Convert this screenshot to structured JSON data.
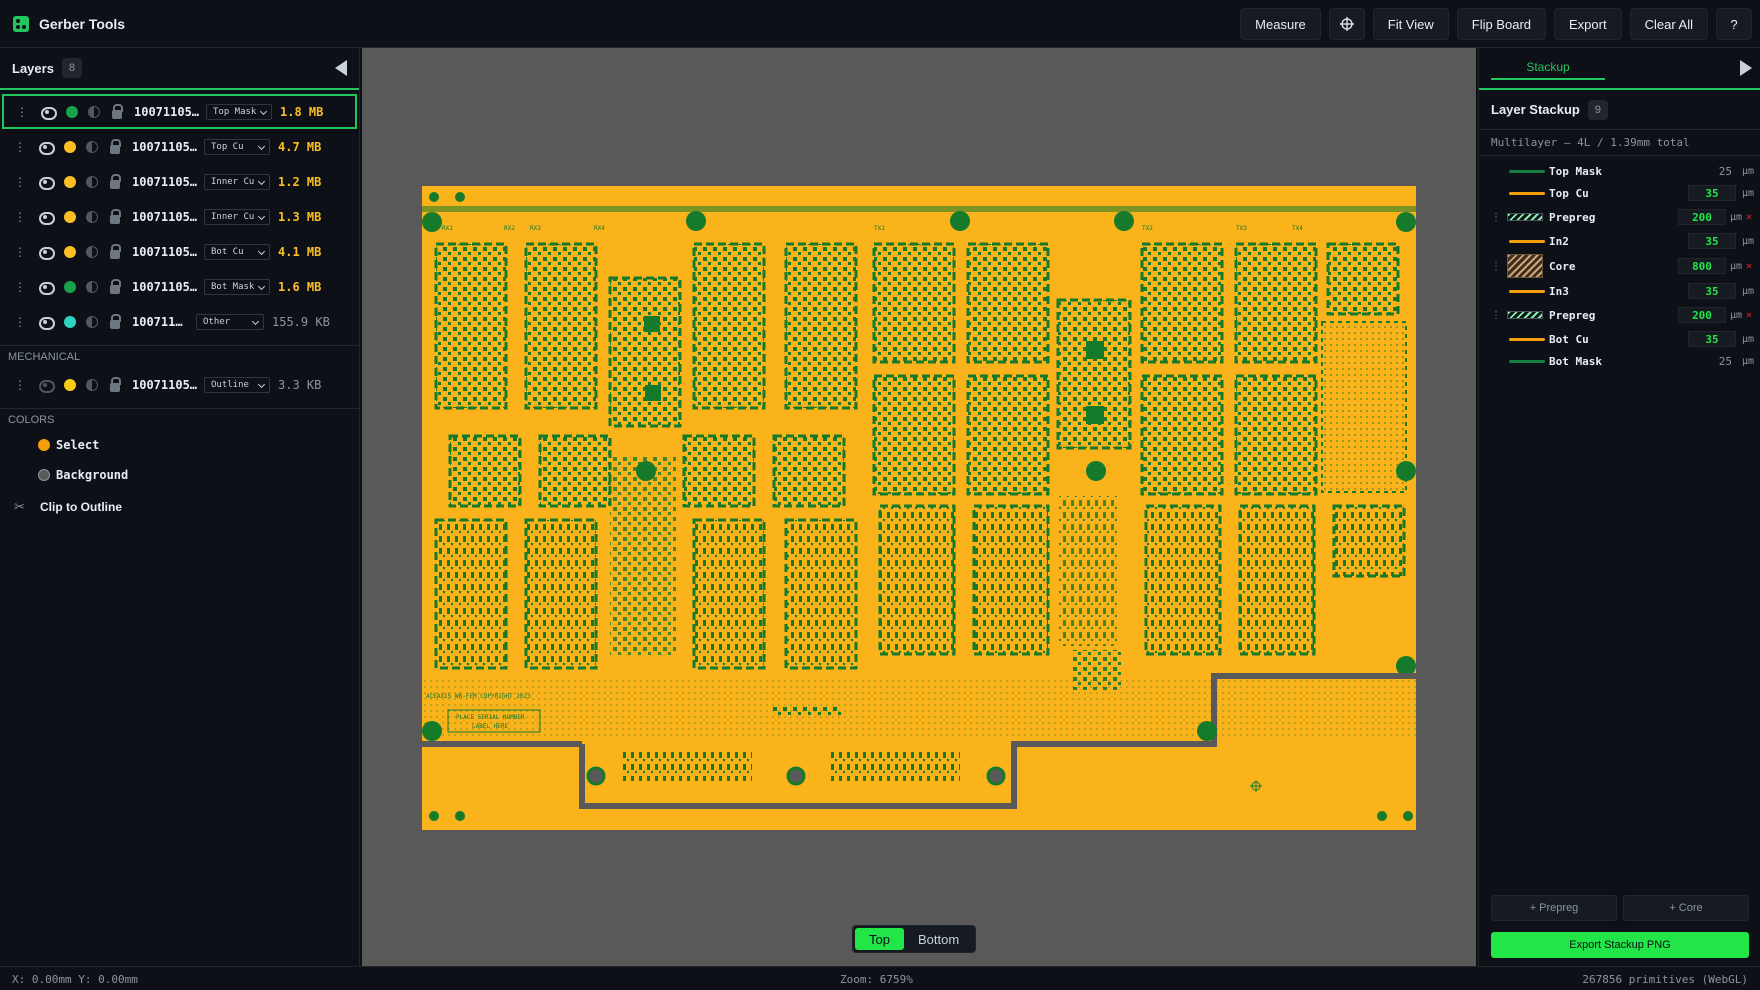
{
  "app": {
    "title": "Gerber Tools"
  },
  "toolbar": {
    "measure": "Measure",
    "crosshair_icon": "crosshair-icon",
    "fit_view": "Fit View",
    "flip_board": "Flip Board",
    "export": "Export",
    "clear_all": "Clear All",
    "help": "?"
  },
  "layers_panel": {
    "title": "Layers",
    "count": "8",
    "layers": [
      {
        "name": "10071105…",
        "type": "Top Mask",
        "size": "1.8 MB",
        "color": "#16a34a",
        "visible": true,
        "selected": true
      },
      {
        "name": "10071105…",
        "type": "Top Cu",
        "size": "4.7 MB",
        "color": "#fbbf24",
        "visible": true
      },
      {
        "name": "10071105…",
        "type": "Inner Cu",
        "size": "1.2 MB",
        "color": "#fbbf24",
        "visible": true
      },
      {
        "name": "10071105…",
        "type": "Inner Cu",
        "size": "1.3 MB",
        "color": "#fbbf24",
        "visible": true
      },
      {
        "name": "10071105…",
        "type": "Bot Cu",
        "size": "4.1 MB",
        "color": "#fbbf24",
        "visible": true
      },
      {
        "name": "10071105…",
        "type": "Bot Mask",
        "size": "1.6 MB",
        "color": "#16a34a",
        "visible": true
      },
      {
        "name": "100711…",
        "type": "Other",
        "size": "155.9 KB",
        "color": "#2dd4bf",
        "visible": true
      }
    ],
    "mechanical_label": "MECHANICAL",
    "mechanical": [
      {
        "name": "10071105…",
        "type": "Outline",
        "size": "3.3 KB",
        "color": "#facc15",
        "visible": false
      }
    ],
    "colors_label": "COLORS",
    "colors": [
      {
        "label": "Select",
        "color": "#f59e0b"
      },
      {
        "label": "Background",
        "color": "#595959"
      }
    ],
    "clip_label": "Clip to Outline"
  },
  "view_toggle": {
    "top": "Top",
    "bottom": "Bottom",
    "active": "Top"
  },
  "stackup_panel": {
    "tab": "Stackup",
    "title": "Layer Stackup",
    "count": "9",
    "summary": "Multilayer — 4L / 1.39mm total",
    "rows": [
      {
        "name": "Top Mask",
        "value": "25",
        "unit": "µm",
        "kind": "mask",
        "editable": false
      },
      {
        "name": "Top Cu",
        "value": "35",
        "unit": "µm",
        "kind": "copper",
        "editable": true
      },
      {
        "name": "Prepreg",
        "value": "200",
        "unit": "µm",
        "kind": "prepreg",
        "editable": true,
        "deletable": true,
        "delete": "×"
      },
      {
        "name": "In2",
        "value": "35",
        "unit": "µm",
        "kind": "copper",
        "editable": true
      },
      {
        "name": "Core",
        "value": "800",
        "unit": "µm",
        "kind": "core",
        "editable": true,
        "deletable": true,
        "delete": "×"
      },
      {
        "name": "In3",
        "value": "35",
        "unit": "µm",
        "kind": "copper",
        "editable": true
      },
      {
        "name": "Prepreg",
        "value": "200",
        "unit": "µm",
        "kind": "prepreg",
        "editable": true,
        "deletable": true,
        "delete": "×"
      },
      {
        "name": "Bot Cu",
        "value": "35",
        "unit": "µm",
        "kind": "copper",
        "editable": true
      },
      {
        "name": "Bot Mask",
        "value": "25",
        "unit": "µm",
        "kind": "mask",
        "editable": false
      }
    ],
    "add_prepreg": "+ Prepreg",
    "add_core": "+ Core",
    "export_png": "Export Stackup PNG"
  },
  "status": {
    "coords": "X: 0.00mm  Y: 0.00mm",
    "zoom": "Zoom: 6759%",
    "primitives": "267856 primitives (WebGL)"
  },
  "board_text": {
    "copyright": "ACEAXIS WB-FEM COPYRIGHT 2023",
    "serial_1": "PLACE SERIAL NUMBER",
    "serial_2": "LABEL HERE",
    "rx": [
      "RX1",
      "RX2",
      "RX3",
      "RX4"
    ],
    "tx": [
      "TX1",
      "TX2",
      "TX3",
      "TX4"
    ]
  },
  "colors": {
    "accent": "#22c55e",
    "board_copper": "#fbb31c",
    "board_mask": "#157a2a",
    "canvas_bg": "#595959"
  }
}
